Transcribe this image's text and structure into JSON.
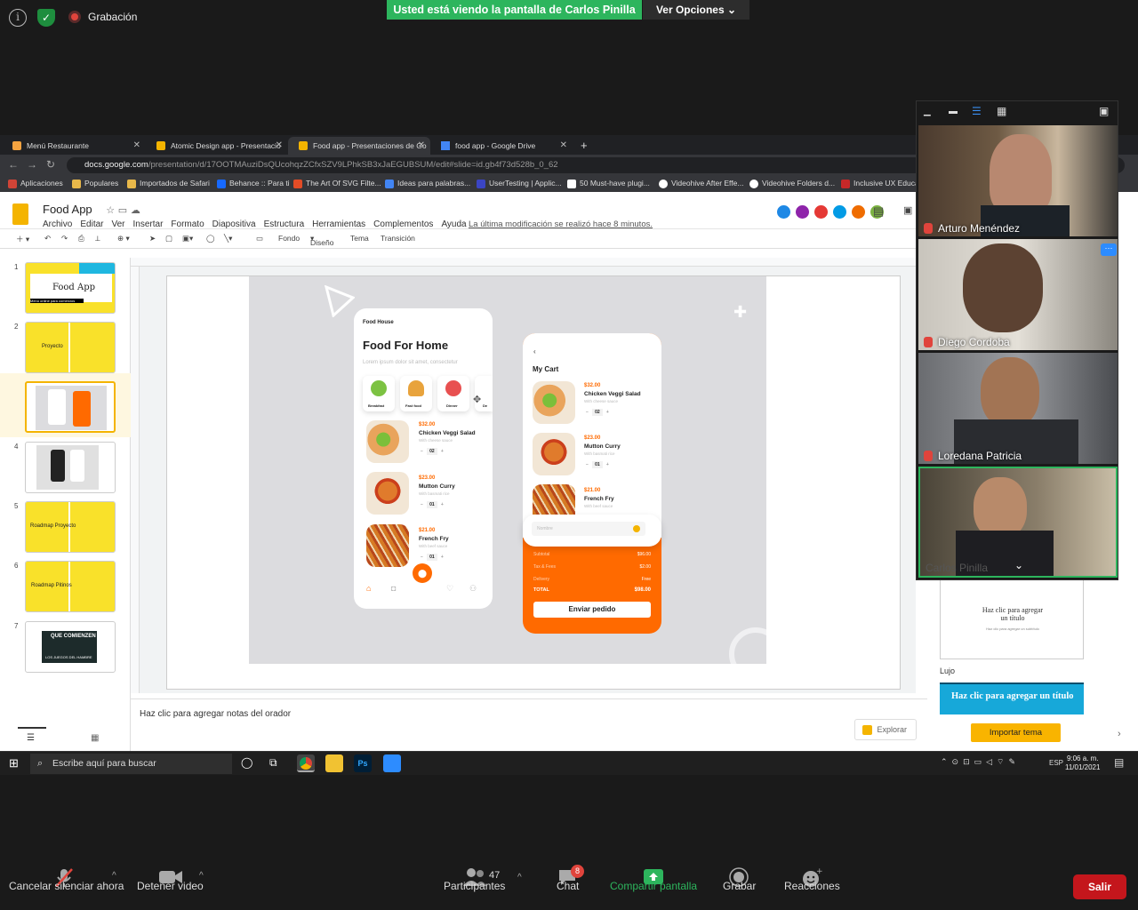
{
  "zoom_top": {
    "info_icon": "info-icon",
    "recording_label": "Grabación",
    "share_banner": "Usted está viendo la pantalla de Carlos Pinilla",
    "view_options": "Ver Opciones"
  },
  "browser": {
    "tabs": [
      {
        "label": "Menú Restaurante",
        "color": "#f4a340"
      },
      {
        "label": "Atomic Design app - Presentacio",
        "color": "#f4b400"
      },
      {
        "label": "Food app - Presentaciones de Go",
        "color": "#f4b400"
      },
      {
        "label": "food app - Google Drive",
        "color": "#4285f4"
      }
    ],
    "url_host": "docs.google.com",
    "url_path": "/presentation/d/17OOTMAuziDsQUcohqzZCfxSZV9LPhkSB3xJaEGUBSUM/edit#slide=id.gb4f73d528b_0_62",
    "bookmarks": [
      "Aplicaciones",
      "Populares",
      "Importados de Safari",
      "Behance :: Para ti",
      "The Art Of SVG Filte...",
      "Ideas para palabras...",
      "UserTesting | Applic...",
      "50 Must-have plugi...",
      "Videohive After Effe...",
      "Videohive Folders d...",
      "Inclusive UX Educat"
    ]
  },
  "slides": {
    "doc_title": "Food App",
    "menu": [
      "Archivo",
      "Editar",
      "Ver",
      "Insertar",
      "Formato",
      "Diapositiva",
      "Estructura",
      "Herramientas",
      "Complementos",
      "Ayuda"
    ],
    "last_edit": "La última modificación se realizó hace 8 minutos.",
    "toolbar": {
      "fondo": "Fondo",
      "diseno": "Diseño",
      "tema": "Tema",
      "transicion": "Transición"
    },
    "thumbnails": [
      {
        "num": "1",
        "title": "Food App",
        "sub": "Menú online para comercios"
      },
      {
        "num": "2",
        "title": "Proyecto"
      },
      {
        "num": "3"
      },
      {
        "num": "4"
      },
      {
        "num": "5",
        "title": "Roadmap Proyecto"
      },
      {
        "num": "6",
        "title": "Roadmap Pitinos"
      },
      {
        "num": "7",
        "title": "QUE COMIENZEN",
        "sub": "LOS JUEGOS DEL HAMBRE"
      }
    ],
    "notes_placeholder": "Haz clic para agregar notas del orador",
    "explore": "Explorar",
    "theme_card_title": "Haz clic para agregar un título",
    "theme_card_sub": "Haz clic para agregar un subtítulo",
    "theme_name": "Lujo",
    "theme2_title": "Haz clic para agregar un título",
    "import_theme": "Importar tema"
  },
  "mockup": {
    "left": {
      "brand": "Food House",
      "title": "Food For Home",
      "subtitle": "Lorem ipsum dolor sit amet, consectetur",
      "categories": [
        "Breakfast",
        "Fast food",
        "Dinner",
        "De"
      ],
      "items": [
        {
          "price": "$32.00",
          "name": "Chicken Veggi Salad",
          "desc": "With cheese sauce",
          "qty": "02"
        },
        {
          "price": "$23.00",
          "name": "Mutton Curry",
          "desc": "With basmati rice",
          "qty": "01"
        },
        {
          "price": "$21.00",
          "name": "French Fry",
          "desc": "With beef sauce",
          "qty": "01"
        }
      ]
    },
    "right": {
      "title": "My Cart",
      "items": [
        {
          "price": "$32.00",
          "name": "Chicken Veggi Salad",
          "desc": "With cheese sauce",
          "qty": "02"
        },
        {
          "price": "$23.00",
          "name": "Mutton Curry",
          "desc": "With basmati rice",
          "qty": "01"
        },
        {
          "price": "$21.00",
          "name": "French Fry",
          "desc": "With beef sauce"
        }
      ],
      "input_placeholder": "Nombre",
      "summary": [
        {
          "label": "Subtotal",
          "value": "$96.00"
        },
        {
          "label": "Tax & Fees",
          "value": "$2.00"
        },
        {
          "label": "Delivery",
          "value": "Free"
        },
        {
          "label": "TOTAL",
          "value": "$98.00"
        }
      ],
      "button": "Enviar pedido"
    }
  },
  "video": {
    "participants": [
      "Arturo Menéndez",
      "Diego Cordoba",
      "Loredana Patricia",
      "Carlos Pinilla"
    ],
    "more": "···"
  },
  "taskbar": {
    "search": "Escribe aquí para buscar",
    "lang": "ESP",
    "time": "9:06 a. m.",
    "date": "11/01/2021"
  },
  "zoom_bottom": {
    "mute": "Cancelar silenciar ahora",
    "video": "Detener video",
    "participants_count": "47",
    "participants": "Participantes",
    "chat_badge": "8",
    "chat": "Chat",
    "share": "Compartir pantalla",
    "record": "Grabar",
    "reactions": "Reacciones",
    "leave": "Salir"
  }
}
